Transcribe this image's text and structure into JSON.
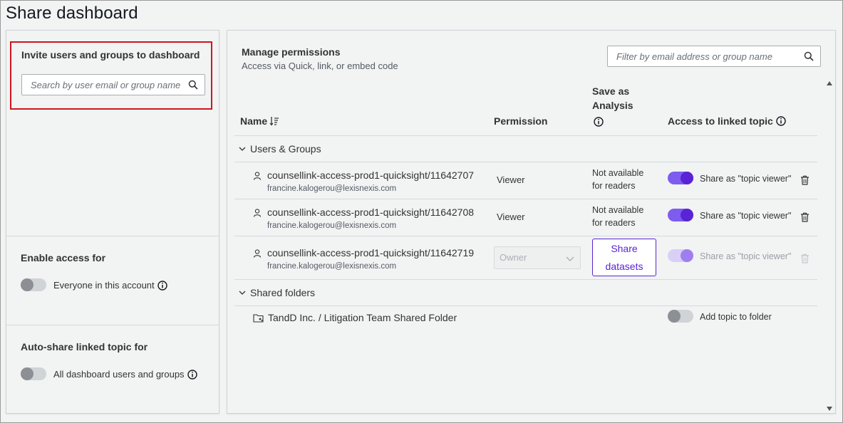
{
  "page": {
    "title": "Share dashboard"
  },
  "invite": {
    "title": "Invite users and groups to dashboard",
    "search_placeholder": "Search by user email or group name"
  },
  "enable_access": {
    "title": "Enable access for",
    "toggle_label": "Everyone in this account",
    "toggle_on": false
  },
  "auto_share": {
    "title": "Auto-share linked topic for",
    "toggle_label": "All dashboard users and groups",
    "toggle_on": false
  },
  "manage": {
    "title": "Manage permissions",
    "subtitle": "Access via Quick, link, or embed code",
    "filter_placeholder": "Filter by email address or group name"
  },
  "table": {
    "headers": {
      "name": "Name",
      "permission": "Permission",
      "save_as_line1": "Save as",
      "save_as_line2": "Analysis",
      "linked_topic": "Access to linked topic"
    },
    "groups": {
      "users_groups": "Users & Groups",
      "shared_folders": "Shared folders"
    },
    "rows": [
      {
        "name": "counsellink-access-prod1-quicksight/11642707",
        "email": "francine.kalogerou@lexisnexis.com",
        "permission": "Viewer",
        "save_as_line1": "Not available",
        "save_as_line2": "for readers",
        "share_label": "Share as \"topic viewer\""
      },
      {
        "name": "counsellink-access-prod1-quicksight/11642708",
        "email": "francine.kalogerou@lexisnexis.com",
        "permission": "Viewer",
        "save_as_line1": "Not available",
        "save_as_line2": "for readers",
        "share_label": "Share as \"topic viewer\""
      },
      {
        "name": "counsellink-access-prod1-quicksight/11642719",
        "email": "francine.kalogerou@lexisnexis.com",
        "permission": "Owner",
        "share_button_line1": "Share",
        "share_button_line2": "datasets",
        "share_label": "Share as \"topic viewer\""
      }
    ],
    "folder": {
      "name": "TandD Inc. / Litigation Team Shared Folder",
      "toggle_label": "Add topic to folder"
    }
  },
  "colors": {
    "accent": "#5a23d5",
    "highlight_border": "#d0151c"
  }
}
